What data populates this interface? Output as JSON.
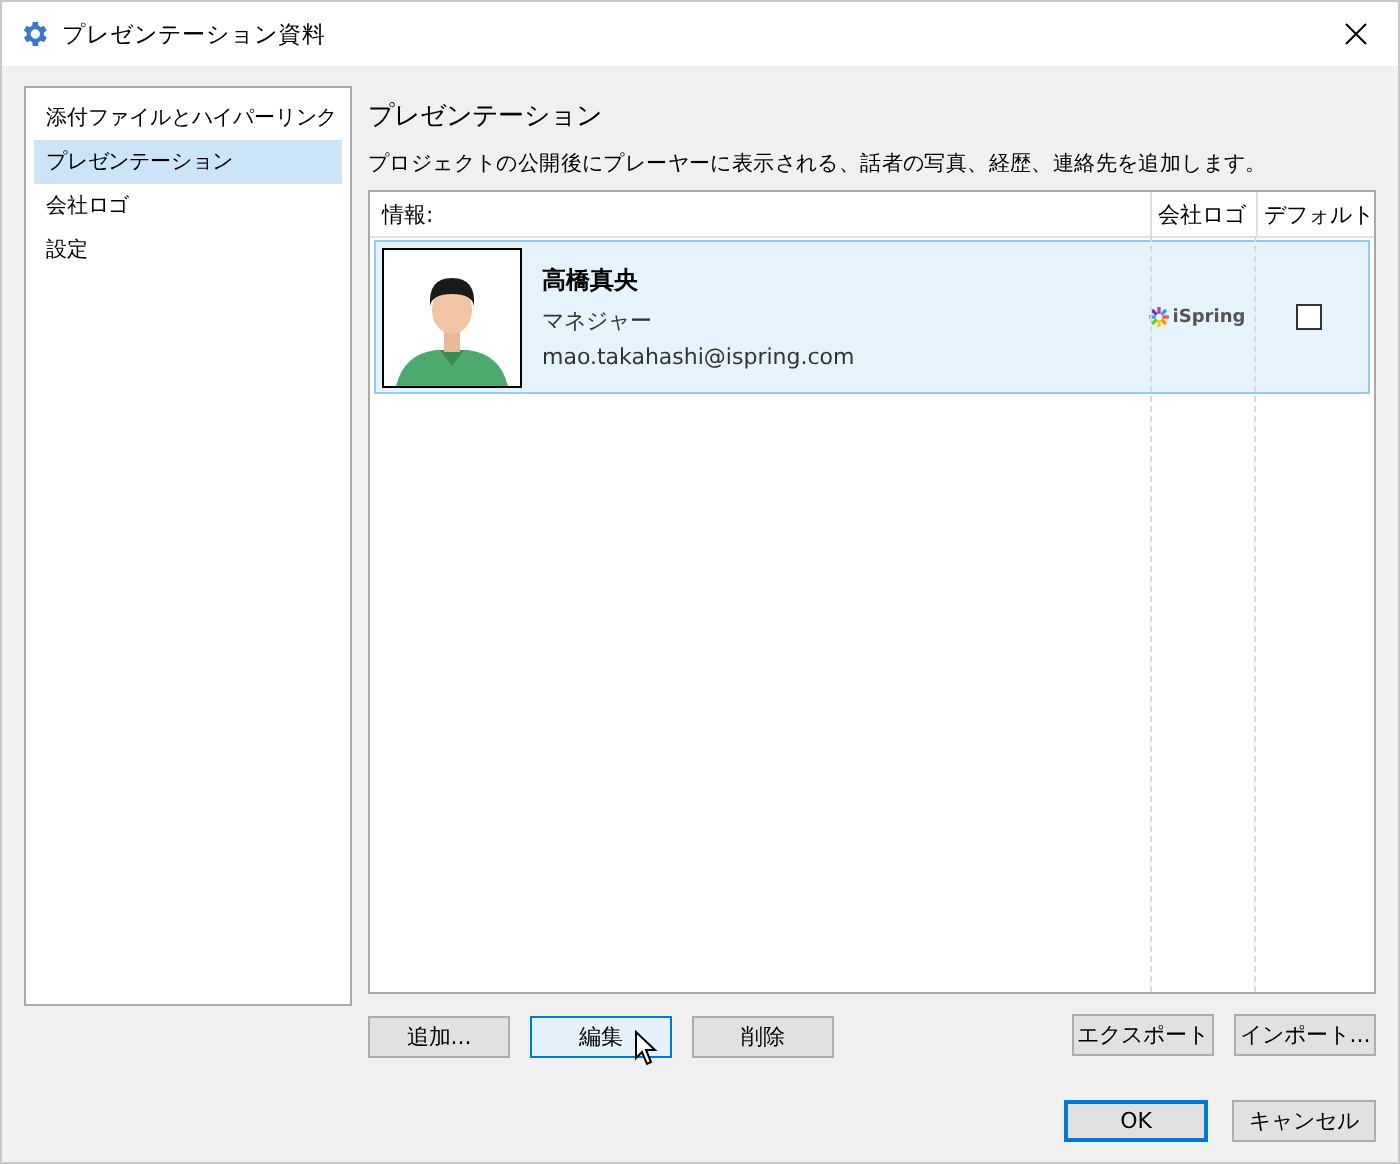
{
  "window": {
    "title": "プレゼンテーション資料"
  },
  "sidebar": {
    "items": [
      {
        "label": "添付ファイルとハイパーリンク",
        "selected": false
      },
      {
        "label": "プレゼンテーション",
        "selected": true
      },
      {
        "label": "会社ロゴ",
        "selected": false
      },
      {
        "label": "設定",
        "selected": false
      }
    ]
  },
  "section": {
    "title": "プレゼンテーション",
    "description": "プロジェクトの公開後にプレーヤーに表示される、話者の写真、経歴、連絡先を追加します。"
  },
  "table": {
    "columns": [
      "情報:",
      "会社ロゴ",
      "デフォルト"
    ],
    "rows": [
      {
        "name": "高橋真央",
        "role": "マネジャー",
        "email": "mao.takahashi@ispring.com",
        "logo": "iSpring",
        "default": false,
        "selected": true
      }
    ]
  },
  "actions": [
    {
      "label": "追加...",
      "hovered": false
    },
    {
      "label": "編集",
      "hovered": true
    },
    {
      "label": "削除",
      "hovered": false
    }
  ],
  "io_buttons": [
    "エクスポート",
    "インポート..."
  ],
  "dialog_buttons": [
    {
      "label": "OK",
      "default": true
    },
    {
      "label": "キャンセル",
      "default": false
    }
  ]
}
